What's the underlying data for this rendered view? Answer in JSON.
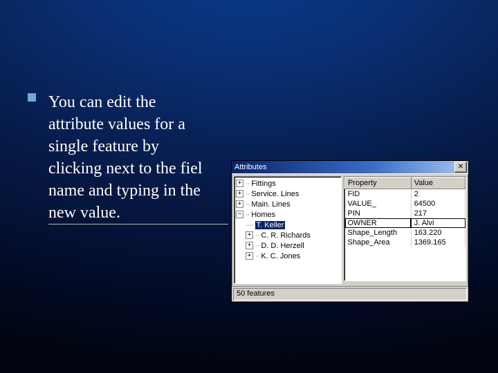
{
  "bullet": {
    "l1": "You can edit the",
    "l2": "attribute values for a",
    "l3": "single feature by",
    "l4": "clicking next to the fiel",
    "l5": "name and typing in the",
    "l6": "new value."
  },
  "window": {
    "title": "Attributes",
    "close": "✕",
    "status": "50 features",
    "tree": {
      "n0": "Fittings",
      "n1": "Service. Lines",
      "n2": "Main. Lines",
      "n3": "Homes",
      "c0": "T. Keller",
      "c1": "C. R. Richards",
      "c2": "D. D. Herzell",
      "c3": "K. C. Jones"
    },
    "grid": {
      "h0": "Property",
      "h1": "Value",
      "r0p": "FID",
      "r0v": "2",
      "r1p": "VALUE_",
      "r1v": "64500",
      "r2p": "PIN",
      "r2v": "217",
      "r3p": "OWNER",
      "r3v": "J. Alvi",
      "r4p": "Shape_Length",
      "r4v": "163.220",
      "r5p": "Shape_Area",
      "r5v": "1369.165"
    }
  }
}
